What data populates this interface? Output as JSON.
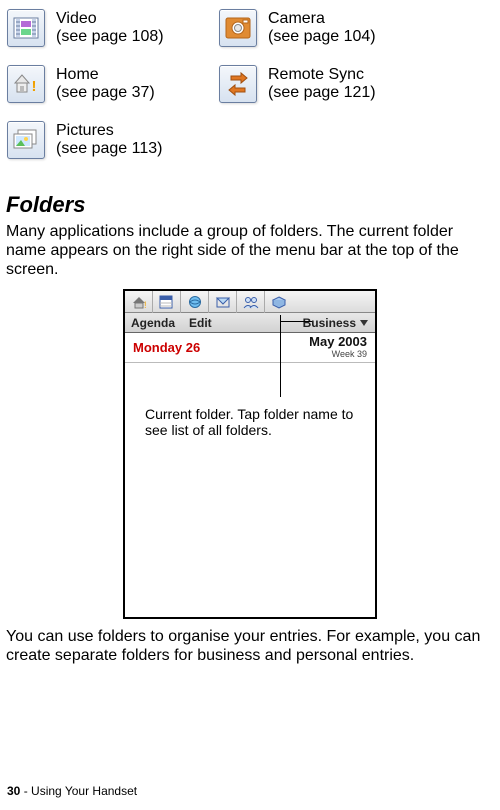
{
  "icons": {
    "video": {
      "name": "Video",
      "page": "(see page 108)"
    },
    "camera": {
      "name": "Camera",
      "page": "(see page 104)"
    },
    "home": {
      "name": "Home",
      "page": "(see page 37)"
    },
    "remote": {
      "name": "Remote Sync",
      "page": "(see page 121)"
    },
    "pictures": {
      "name": "Pictures",
      "page": "(see page 113)"
    }
  },
  "section_heading": "Folders",
  "para1": "Many applications include a group of folders. The current folder name appears on the right side of the menu bar at the top of the screen.",
  "para2": "You can use folders to organise your entries. For example, you can create separate folders for business and personal entries.",
  "screenshot": {
    "menu": {
      "agenda": "Agenda",
      "edit": "Edit",
      "folder": "Business"
    },
    "date": {
      "day": "Monday 26",
      "month": "May 2003",
      "week": "Week 39"
    },
    "callout": "Current folder. Tap folder name to see list of all folders."
  },
  "footer": {
    "page_num": "30",
    "label": " - Using Your Handset"
  }
}
